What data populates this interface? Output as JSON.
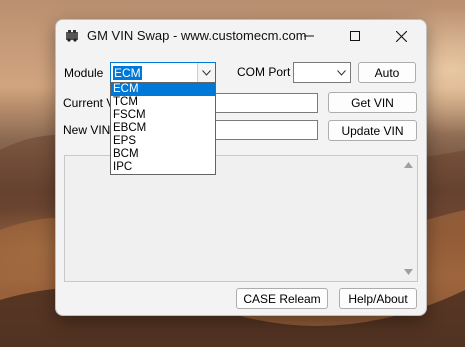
{
  "window": {
    "title": "GM VIN Swap - www.customecm.com"
  },
  "module": {
    "label": "Module",
    "selected": "ECM",
    "options": [
      "ECM",
      "TCM",
      "FSCM",
      "EBCM",
      "EPS",
      "BCM",
      "IPC"
    ]
  },
  "com_port": {
    "label": "COM Port",
    "value": ""
  },
  "buttons": {
    "auto": "Auto",
    "get_vin": "Get VIN",
    "update_vin": "Update VIN",
    "case_relearn": "CASE Releam",
    "help_about": "Help/About"
  },
  "fields": {
    "current_vin_label": "Current VIN",
    "current_vin_visible_label": "Current VI",
    "new_vin_label": "New VIN",
    "current_vin": "",
    "new_vin": ""
  },
  "log": {
    "text": ""
  },
  "colors": {
    "selection": "#0078d7",
    "window_bg": "#f3f3f3"
  }
}
